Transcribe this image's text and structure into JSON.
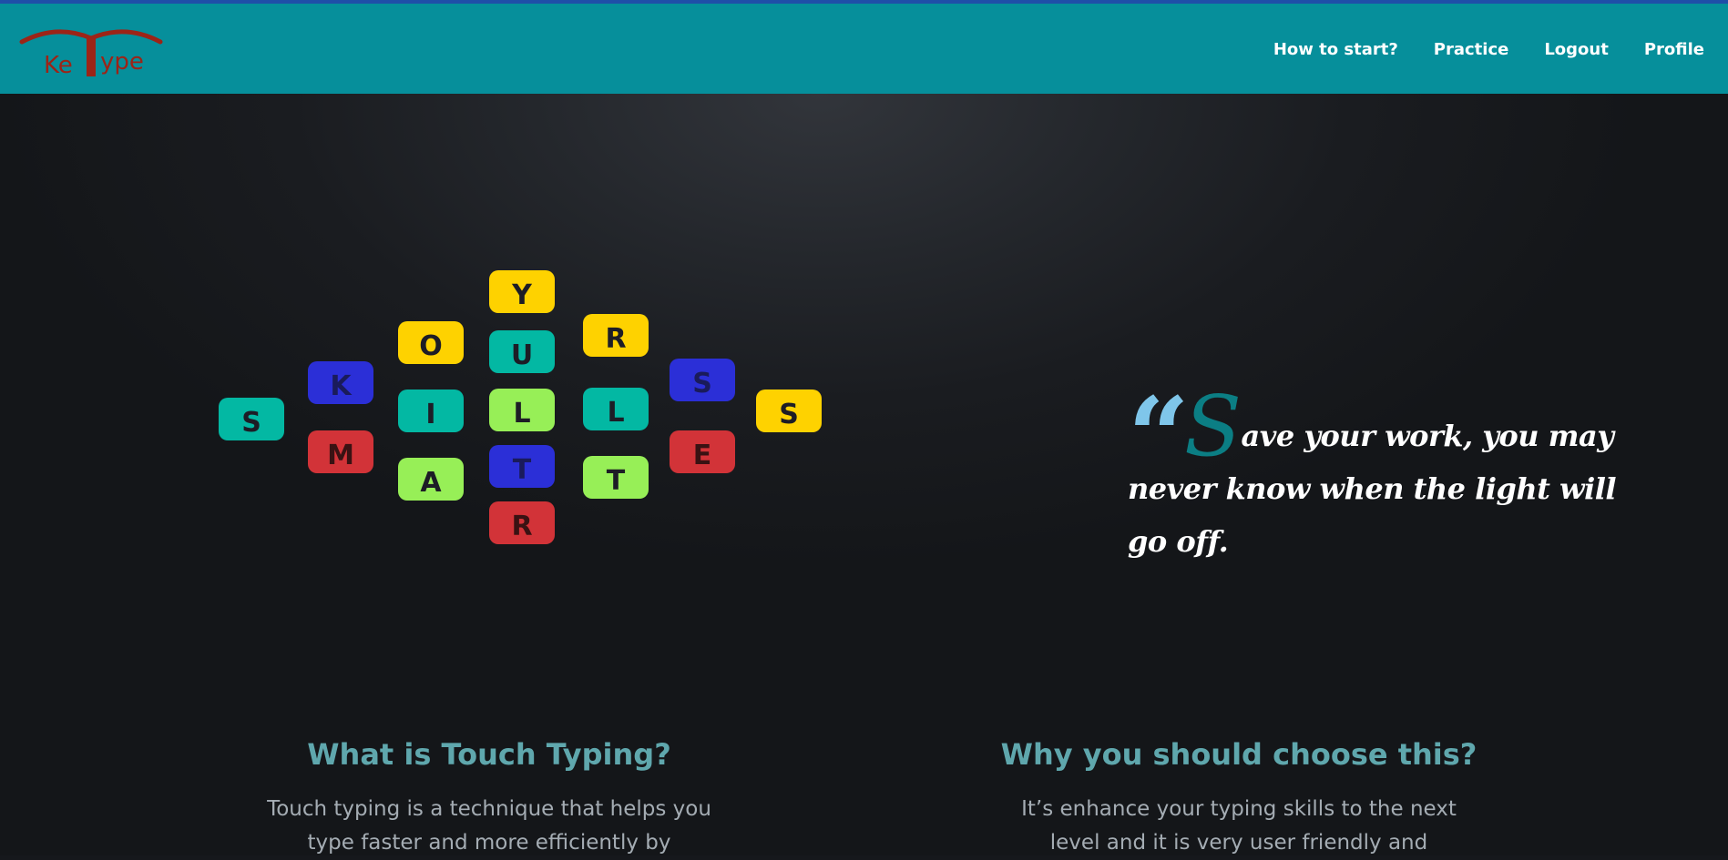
{
  "header": {
    "logo": {
      "text_left": "Ke",
      "text_mid": "T",
      "text_right": "ype",
      "alt": "KeyType logo"
    },
    "nav": [
      {
        "label": "How to start?"
      },
      {
        "label": "Practice"
      },
      {
        "label": "Logout"
      },
      {
        "label": "Profile"
      }
    ]
  },
  "tiles": {
    "c0": [
      "S"
    ],
    "c1": [
      "K",
      "M"
    ],
    "c2": [
      "O",
      "I",
      "A"
    ],
    "c3": [
      "Y",
      "U",
      "L",
      "T",
      "R"
    ],
    "c4": [
      "R",
      "L",
      "T"
    ],
    "c5": [
      "S",
      "E"
    ],
    "c6": [
      "S"
    ]
  },
  "quote": {
    "mark": "“",
    "drop_cap": "S",
    "text": "ave your work, you may never know when the light will go off."
  },
  "sections": [
    {
      "title": "What is Touch Typing?",
      "body_line1": "Touch typing is a technique that helps you",
      "body_line2": "type faster and more efficiently by"
    },
    {
      "title": "Why you should choose this?",
      "body_line1": "It’s enhance your typing skills to the next",
      "body_line2": "level and it is very user friendly and"
    }
  ],
  "colors": {
    "navbar": "#068f9b",
    "tile_yellow": "#fed200",
    "tile_teal": "#03b8a3",
    "tile_green": "#97ef57",
    "tile_blue": "#2b2fd7",
    "tile_red": "#d23338",
    "section_title": "#5fa7ad",
    "quote_mark": "#7fc6ea"
  }
}
